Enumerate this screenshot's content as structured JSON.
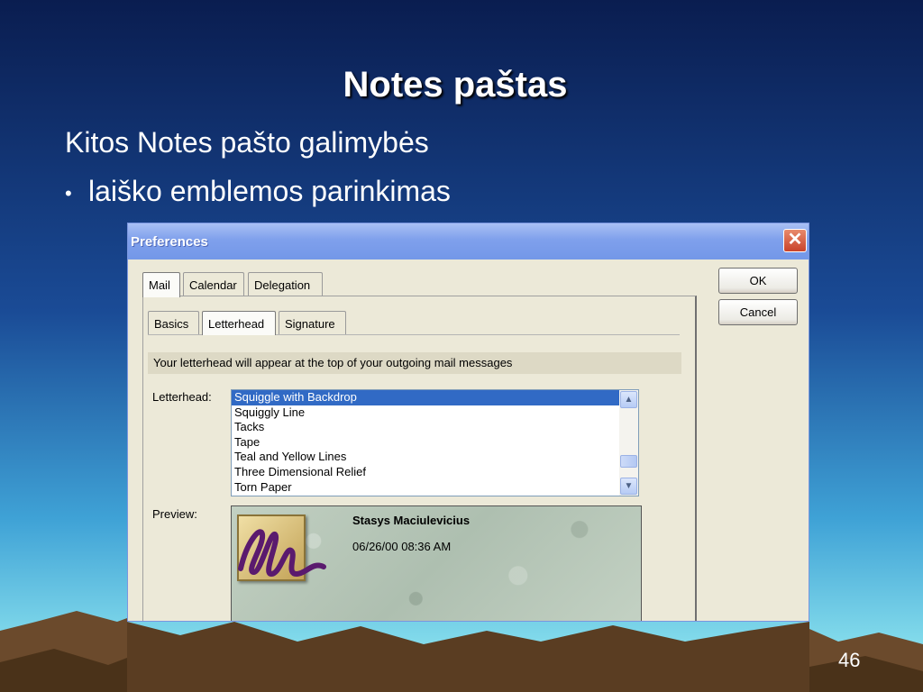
{
  "slide": {
    "title": "Notes paštas",
    "subtitle": "Kitos Notes pašto galimybės",
    "bullet": "laiško emblemos parinkimas",
    "bullet_symbol": "•",
    "page_number": "46"
  },
  "dialog": {
    "title": "Preferences",
    "close_glyph": "✕",
    "top_tabs": [
      {
        "label": "Mail",
        "active": true
      },
      {
        "label": "Calendar",
        "active": false
      },
      {
        "label": "Delegation",
        "active": false
      }
    ],
    "sub_tabs": [
      {
        "label": "Basics",
        "active": false
      },
      {
        "label": "Letterhead",
        "active": true
      },
      {
        "label": "Signature",
        "active": false
      }
    ],
    "info_text": "Your letterhead will appear at the top of your outgoing mail messages",
    "letterhead_label": "Letterhead:",
    "letterhead_options": [
      "Squiggle with Backdrop",
      "Squiggly Line",
      "Tacks",
      "Tape",
      "Teal and Yellow Lines",
      "Three Dimensional Relief",
      "Torn Paper"
    ],
    "selected_index": 0,
    "preview_label": "Preview:",
    "preview": {
      "name": "Stasys Maciulevicius",
      "datetime": "06/26/00 08:36 AM"
    },
    "ok_label": "OK",
    "cancel_label": "Cancel"
  },
  "colors": {
    "selection": "#316ac5",
    "titlebar": "#7fa0ec",
    "dialog_bg": "#ece9d8",
    "squiggle": "#5a1a6e"
  }
}
